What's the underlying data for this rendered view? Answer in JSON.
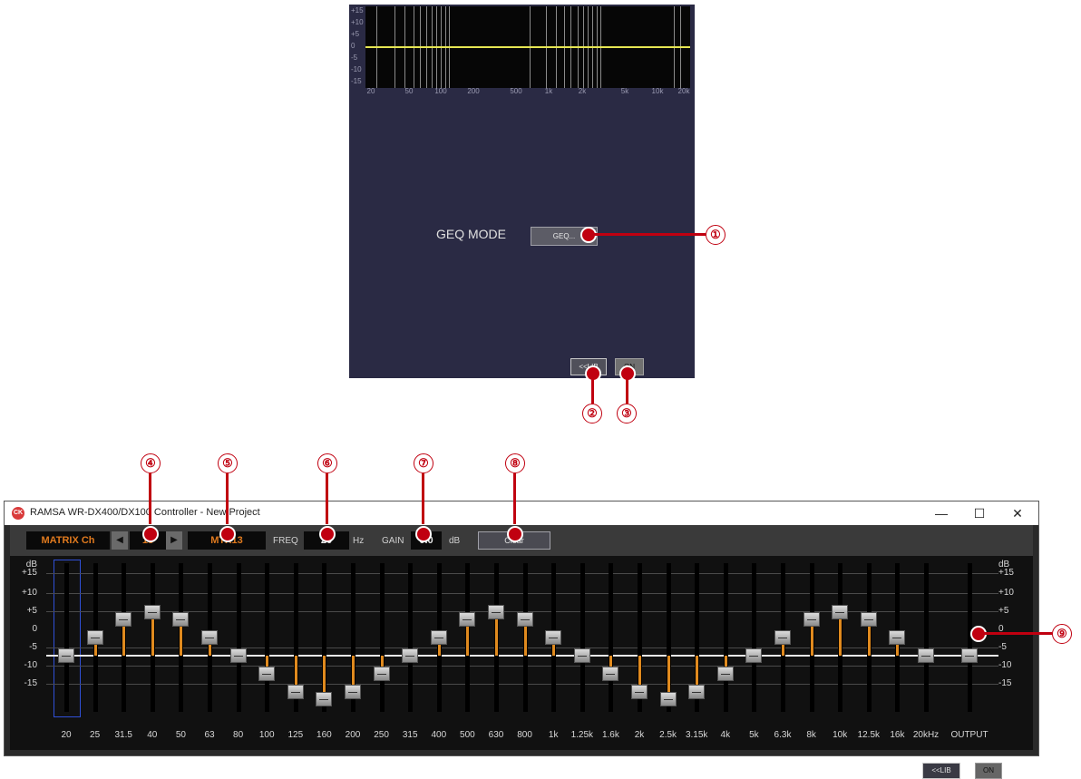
{
  "top_panel": {
    "graph": {
      "y_labels": [
        "+15",
        "+10",
        "+5",
        "0",
        "-5",
        "-10",
        "-15"
      ],
      "x_labels": [
        "20",
        "50",
        "100",
        "200",
        "500",
        "1k",
        "2k",
        "5k",
        "10k",
        "20k"
      ]
    },
    "geq_mode_label": "GEQ MODE",
    "geq_button": "GEQ...",
    "lib_button": "<<LIB",
    "on_button": "ON"
  },
  "callouts": [
    "①",
    "②",
    "③",
    "④",
    "⑤",
    "⑥",
    "⑦",
    "⑧",
    "⑨"
  ],
  "window": {
    "title": "RAMSA WR-DX400/DX100 Controller - New Project",
    "controls": {
      "minimize": "—",
      "maximize": "☐",
      "close": "✕"
    },
    "toolbar": {
      "matrix_label": "MATRIX Ch",
      "channel_number": "13",
      "channel_name": "MTX13",
      "freq_label": "FREQ",
      "freq_value": "20",
      "freq_unit": "Hz",
      "gain_label": "GAIN",
      "gain_value": "0.0",
      "gain_unit": "dB",
      "clear_button": "Clear"
    },
    "db_labels_left": [
      "dB",
      "+15",
      "+10",
      "+5",
      "0",
      "-5",
      "-10",
      "-15"
    ],
    "db_labels_right": [
      "dB",
      "+15",
      "+10",
      "+5",
      "0",
      "-5",
      "-10",
      "-15"
    ],
    "bands": [
      {
        "label": "20",
        "gain": 0
      },
      {
        "label": "25",
        "gain": 5
      },
      {
        "label": "31.5",
        "gain": 10
      },
      {
        "label": "40",
        "gain": 12
      },
      {
        "label": "50",
        "gain": 10
      },
      {
        "label": "63",
        "gain": 5
      },
      {
        "label": "80",
        "gain": 0
      },
      {
        "label": "100",
        "gain": -5
      },
      {
        "label": "125",
        "gain": -10
      },
      {
        "label": "160",
        "gain": -12
      },
      {
        "label": "200",
        "gain": -10
      },
      {
        "label": "250",
        "gain": -5
      },
      {
        "label": "315",
        "gain": 0
      },
      {
        "label": "400",
        "gain": 5
      },
      {
        "label": "500",
        "gain": 10
      },
      {
        "label": "630",
        "gain": 12
      },
      {
        "label": "800",
        "gain": 10
      },
      {
        "label": "1k",
        "gain": 5
      },
      {
        "label": "1.25k",
        "gain": 0
      },
      {
        "label": "1.6k",
        "gain": -5
      },
      {
        "label": "2k",
        "gain": -10
      },
      {
        "label": "2.5k",
        "gain": -12
      },
      {
        "label": "3.15k",
        "gain": -10
      },
      {
        "label": "4k",
        "gain": -5
      },
      {
        "label": "5k",
        "gain": 0
      },
      {
        "label": "6.3k",
        "gain": 5
      },
      {
        "label": "8k",
        "gain": 10
      },
      {
        "label": "10k",
        "gain": 12
      },
      {
        "label": "12.5k",
        "gain": 10
      },
      {
        "label": "16k",
        "gain": 5
      },
      {
        "label": "20kHz",
        "gain": 0
      }
    ],
    "output": {
      "label": "OUTPUT",
      "gain": 0
    },
    "lib_button": "<<LIB",
    "on_button": "ON",
    "colors": {
      "accent_orange": "#e07a1e",
      "fader_bar": "#e08a1e",
      "eq_curve": "#e6e653",
      "callout_red": "#c00010",
      "selection": "#3050d8"
    }
  }
}
